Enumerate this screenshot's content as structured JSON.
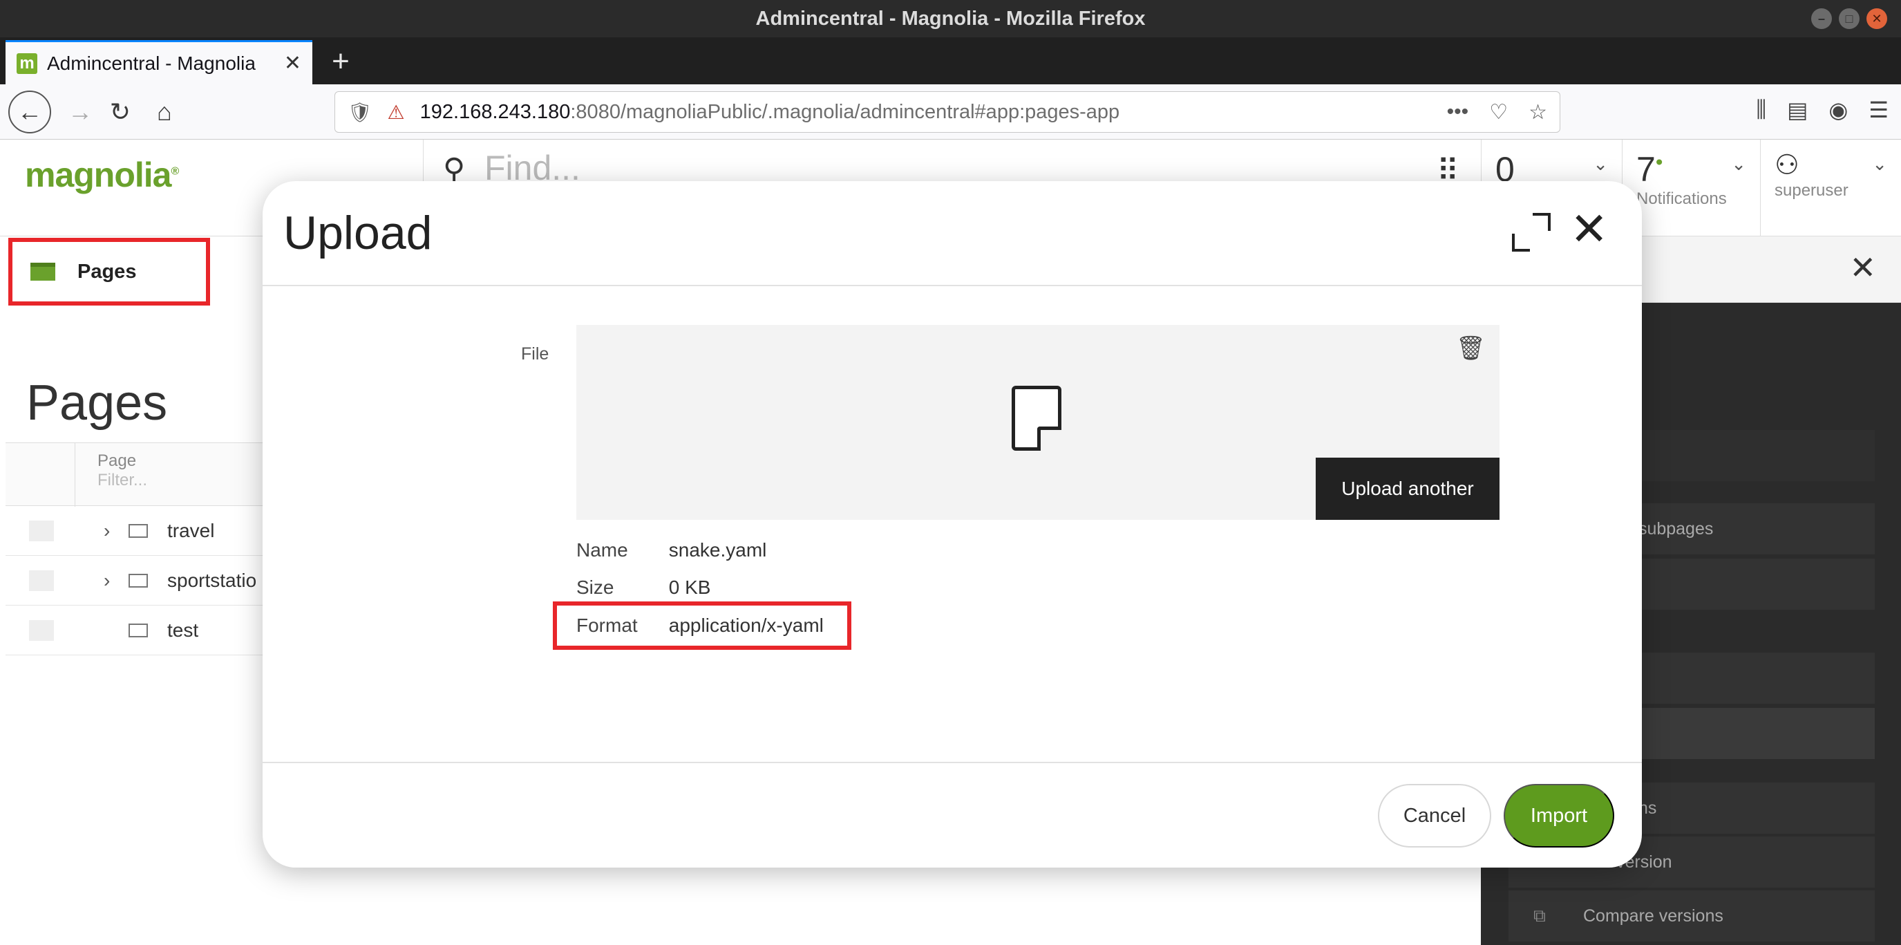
{
  "window": {
    "title": "Admincentral - Magnolia - Mozilla Firefox",
    "controls": [
      "minimize-icon",
      "maximize-icon",
      "close-icon"
    ]
  },
  "browser": {
    "tab": {
      "favicon": "m",
      "title": "Admincentral - Magnolia",
      "close": "✕"
    },
    "new_tab": "+",
    "url": {
      "host": "192.168.243.180",
      "rest": ":8080/magnoliaPublic/.magnolia/admincentral#app:pages-app"
    }
  },
  "app": {
    "logo": "magnolia",
    "find_placeholder": "Find...",
    "tasks_count": "0",
    "notifications": {
      "count": "7",
      "label": "Notifications"
    },
    "user": {
      "label": "superuser"
    },
    "nav_tab": "Pages",
    "page_title": "Pages",
    "tree": {
      "header": {
        "column": "Page",
        "filter": "Filter..."
      },
      "rows": [
        {
          "name": "travel",
          "expandable": true
        },
        {
          "name": "sportstatio",
          "expandable": true
        },
        {
          "name": "test",
          "expandable": false
        }
      ]
    },
    "actions_visible": [
      "cl. subpages",
      "sions",
      "version",
      "Compare versions"
    ]
  },
  "dialog": {
    "title": "Upload",
    "field_label": "File",
    "upload_another": "Upload another",
    "file": {
      "name_label": "Name",
      "name": "snake.yaml",
      "size_label": "Size",
      "size": "0 KB",
      "format_label": "Format",
      "format": "application/x-yaml"
    },
    "cancel": "Cancel",
    "import": "Import"
  }
}
